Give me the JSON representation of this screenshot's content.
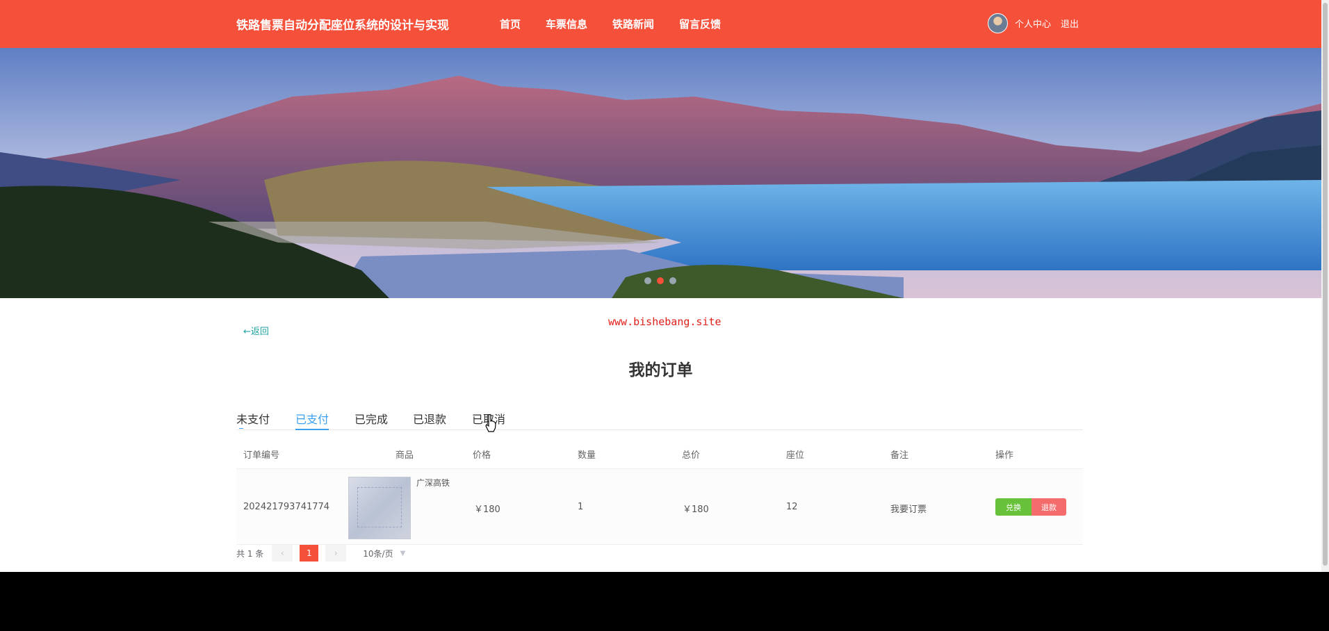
{
  "header": {
    "brand": "铁路售票自动分配座位系统的设计与实现",
    "nav": [
      "首页",
      "车票信息",
      "铁路新闻",
      "留言反馈"
    ],
    "user_center": "个人中心",
    "logout": "退出"
  },
  "banner": {
    "slide_count": 3,
    "active_slide": 2
  },
  "back_label": "←返回",
  "watermark": "www.bishebang.site",
  "page_title": "我的订单",
  "tabs": [
    "未支付",
    "已支付",
    "已完成",
    "已退款",
    "已取消"
  ],
  "active_tab": "已支付",
  "table": {
    "headers": [
      "订单编号",
      "商品",
      "价格",
      "数量",
      "总价",
      "座位",
      "备注",
      "操作"
    ],
    "rows": [
      {
        "order_no": "202421793741774",
        "product": "广深高铁",
        "price": "￥180",
        "quantity": "1",
        "total": "￥180",
        "seat": "12",
        "note": "我要订票",
        "actions": [
          "兑换",
          "退款"
        ]
      }
    ]
  },
  "pagination": {
    "total": "共 1 条",
    "prev": "‹",
    "current": "1",
    "next": "›",
    "page_size": "10条/页"
  },
  "colors": {
    "header": "#f5503a",
    "active_tab": "#3aa0f0",
    "btn_green": "#67c23a",
    "btn_red": "#f56c6c"
  }
}
